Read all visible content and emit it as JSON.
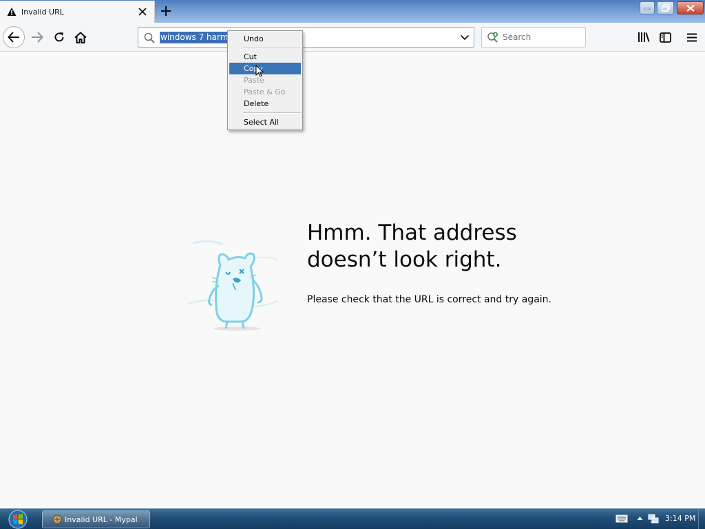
{
  "tab": {
    "title": "Invalid URL",
    "close_label": "×",
    "new_tab_label": "+"
  },
  "urlbar": {
    "value": "windows 7 harmo"
  },
  "searchbar": {
    "placeholder": "Search"
  },
  "context_menu": {
    "items": [
      {
        "label": "Undo",
        "state": "enabled"
      },
      {
        "label": "Cut",
        "state": "enabled"
      },
      {
        "label": "Copy",
        "state": "highlighted"
      },
      {
        "label": "Paste",
        "state": "disabled"
      },
      {
        "label": "Paste & Go",
        "state": "disabled"
      },
      {
        "label": "Delete",
        "state": "enabled"
      },
      {
        "label": "Select All",
        "state": "enabled"
      }
    ]
  },
  "error_page": {
    "title": "Hmm. That address doesn’t look right.",
    "description": "Please check that the URL is correct and try again."
  },
  "taskbar": {
    "task_label": "Invalid URL - Mypal",
    "clock": "3:14 PM"
  },
  "colors": {
    "selection": "#3b6fb6",
    "menu_highlight": "#3a75b5",
    "taskbar": "#1f4e76"
  },
  "icons": [
    "warning-icon",
    "close-icon",
    "plus-icon",
    "back-arrow-icon",
    "forward-arrow-icon",
    "reload-icon",
    "home-icon",
    "search-icon",
    "chevron-down-icon",
    "search-engine-icon",
    "library-icon",
    "sidebar-icon",
    "hamburger-menu-icon",
    "mascot-illustration",
    "windows-start-icon",
    "app-icon",
    "keyboard-icon",
    "tray-arrow-icon",
    "network-icon",
    "mouse-cursor-icon"
  ]
}
